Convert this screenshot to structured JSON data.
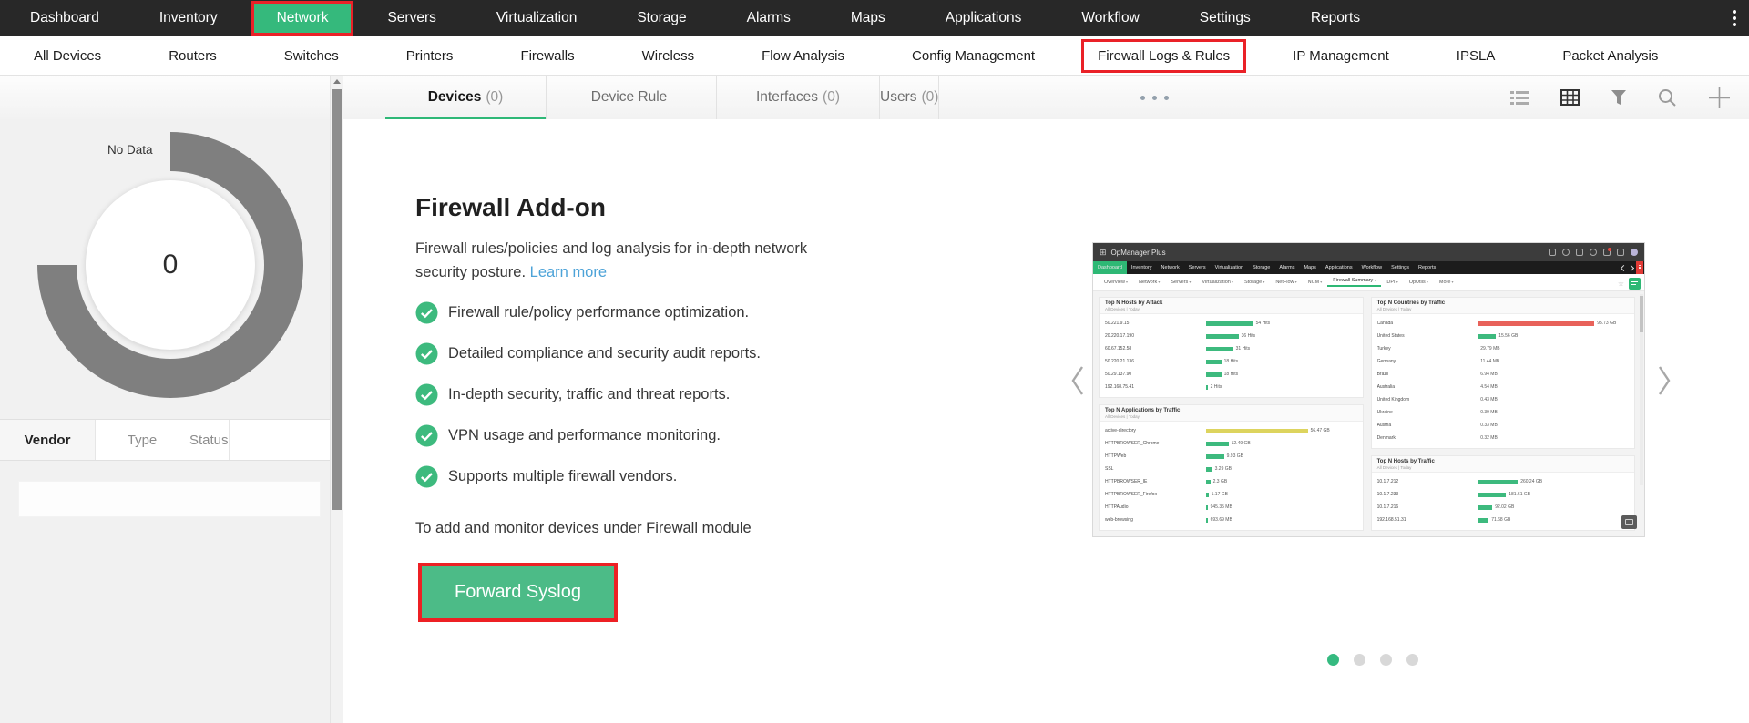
{
  "topnav": {
    "items": [
      {
        "label": "Dashboard"
      },
      {
        "label": "Inventory"
      },
      {
        "label": "Network",
        "cls": "active"
      },
      {
        "label": "Servers"
      },
      {
        "label": "Virtualization"
      },
      {
        "label": "Storage"
      },
      {
        "label": "Alarms"
      },
      {
        "label": "Maps"
      },
      {
        "label": "Applications"
      },
      {
        "label": "Workflow"
      },
      {
        "label": "Settings"
      },
      {
        "label": "Reports"
      }
    ],
    "overflow_icon": "kebab-menu-icon"
  },
  "subnav": {
    "items": [
      {
        "label": "All Devices"
      },
      {
        "label": "Routers"
      },
      {
        "label": "Switches"
      },
      {
        "label": "Printers"
      },
      {
        "label": "Firewalls"
      },
      {
        "label": "Wireless"
      },
      {
        "label": "Flow Analysis"
      },
      {
        "label": "Config Management"
      },
      {
        "label": "Firewall Logs & Rules",
        "cls": "hl"
      },
      {
        "label": "IP Management"
      },
      {
        "label": "IPSLA"
      },
      {
        "label": "Packet Analysis"
      }
    ]
  },
  "tabs": {
    "items": [
      {
        "label": "Devices",
        "count": "(0)",
        "cls": "active"
      },
      {
        "label": "Device Rule",
        "count": ""
      },
      {
        "label": "Interfaces",
        "count": "(0)"
      },
      {
        "label": "Users",
        "count": "(0)"
      }
    ],
    "toolbar_icons": [
      "list-view-icon",
      "grid-view-icon",
      "filter-icon",
      "search-icon",
      "add-icon"
    ],
    "more_menu_icon": "ellipsis-icon"
  },
  "sidebar": {
    "chart": {
      "type": "donut",
      "label": "No Data",
      "value": "0"
    },
    "tabs": [
      {
        "label": "Vendor",
        "cls": "active"
      },
      {
        "label": "Type"
      },
      {
        "label": "Status"
      }
    ]
  },
  "main": {
    "title": "Firewall Add-on",
    "description": "Firewall rules/policies and log analysis for in-depth network security posture.",
    "learn_more_label": "Learn more",
    "features": [
      "Firewall rule/policy performance optimization.",
      "Detailed compliance and security audit reports.",
      "In-depth security, traffic and threat reports.",
      "VPN usage and performance monitoring.",
      "Supports multiple firewall vendors."
    ],
    "footer_note": "To add and monitor devices under Firewall module",
    "cta_label": "Forward Syslog"
  },
  "carousel": {
    "dots": [
      {
        "cls": "on"
      },
      {},
      {},
      {}
    ]
  },
  "preview": {
    "app_title": "OpManager Plus",
    "icons": {
      "apps_grid": "⊞",
      "star": "☆"
    },
    "menu": [
      {
        "label": "Dashboard",
        "cls": "on"
      },
      {
        "label": "Inventory"
      },
      {
        "label": "Network"
      },
      {
        "label": "Servers"
      },
      {
        "label": "Virtualization"
      },
      {
        "label": "Storage"
      },
      {
        "label": "Alarms"
      },
      {
        "label": "Maps"
      },
      {
        "label": "Applications"
      },
      {
        "label": "Workflow"
      },
      {
        "label": "Settings"
      },
      {
        "label": "Reports"
      }
    ],
    "subnav": [
      {
        "label": "Overview"
      },
      {
        "label": "Network"
      },
      {
        "label": "Servers"
      },
      {
        "label": "Virtualization"
      },
      {
        "label": "Storage"
      },
      {
        "label": "NetFlow"
      },
      {
        "label": "NCM"
      },
      {
        "label": "Firewall Summary",
        "cls": "on"
      },
      {
        "label": "DPI"
      },
      {
        "label": "OpUtils"
      },
      {
        "label": "More"
      }
    ],
    "columns": [
      {
        "panels": [
          {
            "title": "Top N Hosts by Attack",
            "subtitle": "All Devices | Today",
            "rows": [
              {
                "label": "50.221.9.15",
                "value": "54 Hits",
                "bar": 52,
                "cls": "g"
              },
              {
                "label": "20.220.17.190",
                "value": "36 Hits",
                "bar": 36,
                "cls": "g"
              },
              {
                "label": "60.67.152.58",
                "value": "31 Hits",
                "bar": 30,
                "cls": "g"
              },
              {
                "label": "50.220.21.136",
                "value": "18 Hits",
                "bar": 17,
                "cls": "g"
              },
              {
                "label": "50.29.137.90",
                "value": "18 Hits",
                "bar": 17,
                "cls": "g"
              },
              {
                "label": "192.168.75.41",
                "value": "2 Hits",
                "bar": 2,
                "cls": "g"
              }
            ]
          },
          {
            "title": "Top N Applications by Traffic",
            "subtitle": "All Devices | Today",
            "rows": [
              {
                "label": "active-directory",
                "value": "56.47 GB",
                "bar": 112,
                "cls": "y"
              },
              {
                "label": "HTTPBROWSER_Chrome",
                "value": "12.49 GB",
                "bar": 25,
                "cls": "g"
              },
              {
                "label": "HTTPWeb",
                "value": "9.93 GB",
                "bar": 20,
                "cls": "g"
              },
              {
                "label": "SSL",
                "value": "3.29 GB",
                "bar": 7,
                "cls": "g"
              },
              {
                "label": "HTTPBROWSER_IE",
                "value": "2.3 GB",
                "bar": 5,
                "cls": "g"
              },
              {
                "label": "HTTPBROWSER_Firefox",
                "value": "1.17 GB",
                "bar": 3,
                "cls": "g"
              },
              {
                "label": "HTTPAudio",
                "value": "945.35 MB",
                "bar": 2,
                "cls": "g"
              },
              {
                "label": "web-browsing",
                "value": "693.69 MB",
                "bar": 2,
                "cls": "g"
              }
            ]
          }
        ]
      },
      {
        "panels": [
          {
            "title": "Top N Countries by Traffic",
            "subtitle": "All Devices | Today",
            "rows": [
              {
                "label": "Canada",
                "value": "95.73 GB",
                "bar": 128,
                "cls": "r"
              },
              {
                "label": "United States",
                "value": "15.56 GB",
                "bar": 20,
                "cls": "g"
              },
              {
                "label": "Turkey",
                "value": "29.79 MB",
                "bar": 0
              },
              {
                "label": "Germany",
                "value": "11.44 MB",
                "bar": 0
              },
              {
                "label": "Brazil",
                "value": "6.94 MB",
                "bar": 0
              },
              {
                "label": "Australia",
                "value": "4.54 MB",
                "bar": 0
              },
              {
                "label": "United Kingdom",
                "value": "0.43 MB",
                "bar": 0
              },
              {
                "label": "Ukraine",
                "value": "0.39 MB",
                "bar": 0
              },
              {
                "label": "Austria",
                "value": "0.33 MB",
                "bar": 0
              },
              {
                "label": "Denmark",
                "value": "0.32 MB",
                "bar": 0
              }
            ]
          },
          {
            "title": "Top N Hosts by Traffic",
            "subtitle": "All Devices | Today",
            "rows": [
              {
                "label": "10.1.7.212",
                "value": "260.24 GB",
                "bar": 44,
                "cls": "g"
              },
              {
                "label": "10.1.7.233",
                "value": "181.61 GB",
                "bar": 31,
                "cls": "g"
              },
              {
                "label": "10.1.7.216",
                "value": "92.02 GB",
                "bar": 16,
                "cls": "g"
              },
              {
                "label": "192.168.51.31",
                "value": "71.68 GB",
                "bar": 12,
                "cls": "g"
              }
            ]
          }
        ]
      }
    ]
  },
  "colors": {
    "accent_green": "#2eb877",
    "cta_green": "#4cbb87",
    "annotation_red": "#ed2024",
    "donut_gray": "#7f7f7f",
    "bar_red": "#e8625a",
    "bar_yellow": "#ddd45e",
    "link_blue": "#4da3d8"
  }
}
